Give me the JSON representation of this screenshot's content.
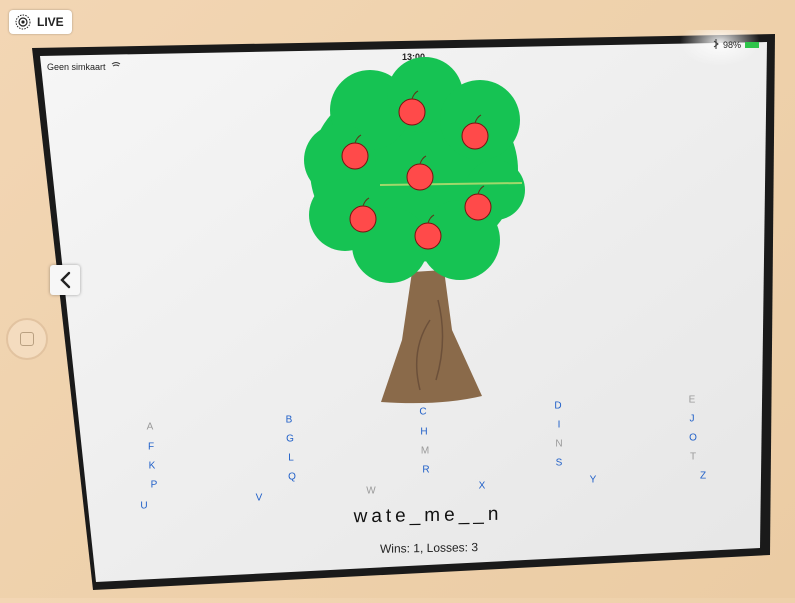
{
  "photo_overlay": {
    "live_label": "LIVE"
  },
  "status_bar": {
    "carrier": "Geen simkaart",
    "time": "13:00",
    "battery": "98%"
  },
  "game": {
    "apples_count": 7,
    "word_display": "wate_me__n",
    "score_text": "Wins: 1, Losses: 3",
    "letters": [
      {
        "ch": "A",
        "used": true
      },
      {
        "ch": "F",
        "used": false
      },
      {
        "ch": "K",
        "used": false
      },
      {
        "ch": "P",
        "used": false
      },
      {
        "ch": "U",
        "used": false
      },
      {
        "ch": "B",
        "used": false
      },
      {
        "ch": "G",
        "used": false
      },
      {
        "ch": "L",
        "used": false
      },
      {
        "ch": "Q",
        "used": false
      },
      {
        "ch": "V",
        "used": false
      },
      {
        "ch": "C",
        "used": false
      },
      {
        "ch": "H",
        "used": false
      },
      {
        "ch": "M",
        "used": true
      },
      {
        "ch": "R",
        "used": false
      },
      {
        "ch": "W",
        "used": true
      },
      {
        "ch": "D",
        "used": false
      },
      {
        "ch": "I",
        "used": false
      },
      {
        "ch": "N",
        "used": true
      },
      {
        "ch": "S",
        "used": false
      },
      {
        "ch": "X",
        "used": false
      },
      {
        "ch": "E",
        "used": true
      },
      {
        "ch": "J",
        "used": false
      },
      {
        "ch": "O",
        "used": false
      },
      {
        "ch": "T",
        "used": true
      },
      {
        "ch": "Y",
        "used": false
      },
      {
        "ch": "Z",
        "used": false
      }
    ]
  },
  "colors": {
    "tree_green": "#16c353",
    "trunk_brown": "#8a6a4a",
    "apple_red": "#ff4a4a",
    "letter_blue": "#1f5fc8",
    "letter_used": "#9a9a9a"
  }
}
